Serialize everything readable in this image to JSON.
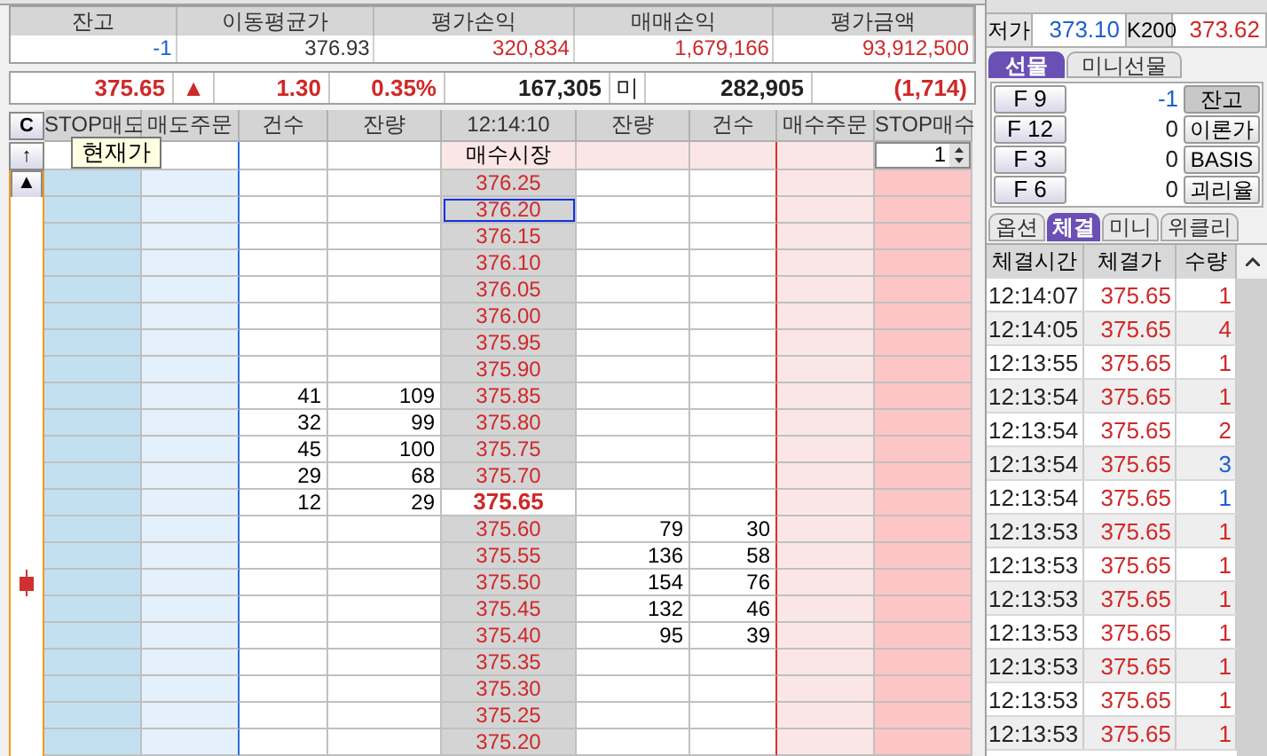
{
  "balance_table": {
    "columns": [
      "잔고",
      "이동평균가",
      "평가손익",
      "매매손익",
      "평가금액"
    ],
    "values": [
      {
        "text": "-1",
        "color": "#2060d0"
      },
      {
        "text": "376.93",
        "color": "#333333"
      },
      {
        "text": "320,834",
        "color": "#d02828"
      },
      {
        "text": "1,679,166",
        "color": "#d02828"
      },
      {
        "text": "93,912,500",
        "color": "#d02828"
      }
    ]
  },
  "price_bar": {
    "price": "375.65",
    "arrow": "▲",
    "change": "1.30",
    "rate": "0.35%",
    "volume": "167,305",
    "label": "미",
    "open_interest": "282,905",
    "oi_change": "(1,714)"
  },
  "order_book": {
    "side_buttons": [
      "C",
      "↑",
      "▲"
    ],
    "columns": [
      "STOP매도",
      "매도주문",
      "건수",
      "잔량",
      "12:14:10",
      "잔량",
      "건수",
      "매수주문",
      "STOP매수"
    ],
    "market_label": "매수시장",
    "quantity": "1",
    "tooltip": "현재가",
    "rows": [
      {
        "price": "376.25",
        "current": false,
        "selected": false,
        "marker": false
      },
      {
        "price": "376.20",
        "current": false,
        "selected": true,
        "marker": false
      },
      {
        "price": "376.15",
        "current": false,
        "selected": false,
        "marker": false
      },
      {
        "price": "376.10",
        "current": false,
        "selected": false,
        "marker": false
      },
      {
        "price": "376.05",
        "current": false,
        "selected": false,
        "marker": false
      },
      {
        "price": "376.00",
        "current": false,
        "selected": false,
        "marker": false
      },
      {
        "price": "375.95",
        "current": false,
        "selected": false,
        "marker": false
      },
      {
        "price": "375.90",
        "current": false,
        "selected": false,
        "marker": false
      },
      {
        "price": "375.85",
        "ask_count": "41",
        "ask_qty": "109",
        "current": false,
        "selected": false,
        "marker": false
      },
      {
        "price": "375.80",
        "ask_count": "32",
        "ask_qty": "99",
        "current": false,
        "selected": false,
        "marker": false
      },
      {
        "price": "375.75",
        "ask_count": "45",
        "ask_qty": "100",
        "current": false,
        "selected": false,
        "marker": false
      },
      {
        "price": "375.70",
        "ask_count": "29",
        "ask_qty": "68",
        "current": false,
        "selected": false,
        "marker": false
      },
      {
        "price": "375.65",
        "ask_count": "12",
        "ask_qty": "29",
        "current": true,
        "selected": false,
        "marker": false
      },
      {
        "price": "375.60",
        "bid_qty": "79",
        "bid_count": "30",
        "current": false,
        "selected": false,
        "marker": false
      },
      {
        "price": "375.55",
        "bid_qty": "136",
        "bid_count": "58",
        "current": false,
        "selected": false,
        "marker": false
      },
      {
        "price": "375.50",
        "bid_qty": "154",
        "bid_count": "76",
        "current": false,
        "selected": false,
        "marker": true
      },
      {
        "price": "375.45",
        "bid_qty": "132",
        "bid_count": "46",
        "current": false,
        "selected": false,
        "marker": false
      },
      {
        "price": "375.40",
        "bid_qty": "95",
        "bid_count": "39",
        "current": false,
        "selected": false,
        "marker": false
      },
      {
        "price": "375.35",
        "current": false,
        "selected": false,
        "marker": false
      },
      {
        "price": "375.30",
        "current": false,
        "selected": false,
        "marker": false
      },
      {
        "price": "375.25",
        "current": false,
        "selected": false,
        "marker": false
      },
      {
        "price": "375.20",
        "current": false,
        "selected": false,
        "marker": false
      }
    ]
  },
  "quote": [
    {
      "label": "저가",
      "value": "373.10",
      "color": "#2060d0"
    },
    {
      "label": "K200",
      "value": "373.62",
      "color": "#d02828"
    }
  ],
  "market_tabs": [
    {
      "label": "선물",
      "selected": true
    },
    {
      "label": "미니선물",
      "selected": false
    }
  ],
  "accounts": [
    {
      "key": "F 9",
      "value": "-1",
      "color": "#2060d0",
      "action": "잔고",
      "selected": true
    },
    {
      "key": "F 12",
      "value": "0",
      "color": "#222222",
      "action": "이론가",
      "selected": false
    },
    {
      "key": "F 3",
      "value": "0",
      "color": "#222222",
      "action": "BASIS",
      "selected": false
    },
    {
      "key": "F 6",
      "value": "0",
      "color": "#222222",
      "action": "괴리율",
      "selected": false
    }
  ],
  "trade_tabs": [
    {
      "label": "옵션",
      "selected": false
    },
    {
      "label": "체결",
      "selected": true
    },
    {
      "label": "미니",
      "selected": false
    },
    {
      "label": "위클리",
      "selected": false
    }
  ],
  "trades": {
    "columns": [
      "체결시간",
      "체결가",
      "수량"
    ],
    "rows": [
      {
        "time": "12:14:07",
        "price": "375.65",
        "qty": "1",
        "color": "#d02828"
      },
      {
        "time": "12:14:05",
        "price": "375.65",
        "qty": "4",
        "color": "#d02828"
      },
      {
        "time": "12:13:55",
        "price": "375.65",
        "qty": "1",
        "color": "#d02828"
      },
      {
        "time": "12:13:54",
        "price": "375.65",
        "qty": "1",
        "color": "#d02828"
      },
      {
        "time": "12:13:54",
        "price": "375.65",
        "qty": "2",
        "color": "#d02828"
      },
      {
        "time": "12:13:54",
        "price": "375.65",
        "qty": "3",
        "color": "#2060d0"
      },
      {
        "time": "12:13:54",
        "price": "375.65",
        "qty": "1",
        "color": "#2060d0"
      },
      {
        "time": "12:13:53",
        "price": "375.65",
        "qty": "1",
        "color": "#d02828"
      },
      {
        "time": "12:13:53",
        "price": "375.65",
        "qty": "1",
        "color": "#d02828"
      },
      {
        "time": "12:13:53",
        "price": "375.65",
        "qty": "1",
        "color": "#d02828"
      },
      {
        "time": "12:13:53",
        "price": "375.65",
        "qty": "1",
        "color": "#d02828"
      },
      {
        "time": "12:13:53",
        "price": "375.65",
        "qty": "1",
        "color": "#d02828"
      },
      {
        "time": "12:13:53",
        "price": "375.65",
        "qty": "1",
        "color": "#d02828"
      },
      {
        "time": "12:13:53",
        "price": "375.65",
        "qty": "1",
        "color": "#d02828"
      }
    ]
  }
}
